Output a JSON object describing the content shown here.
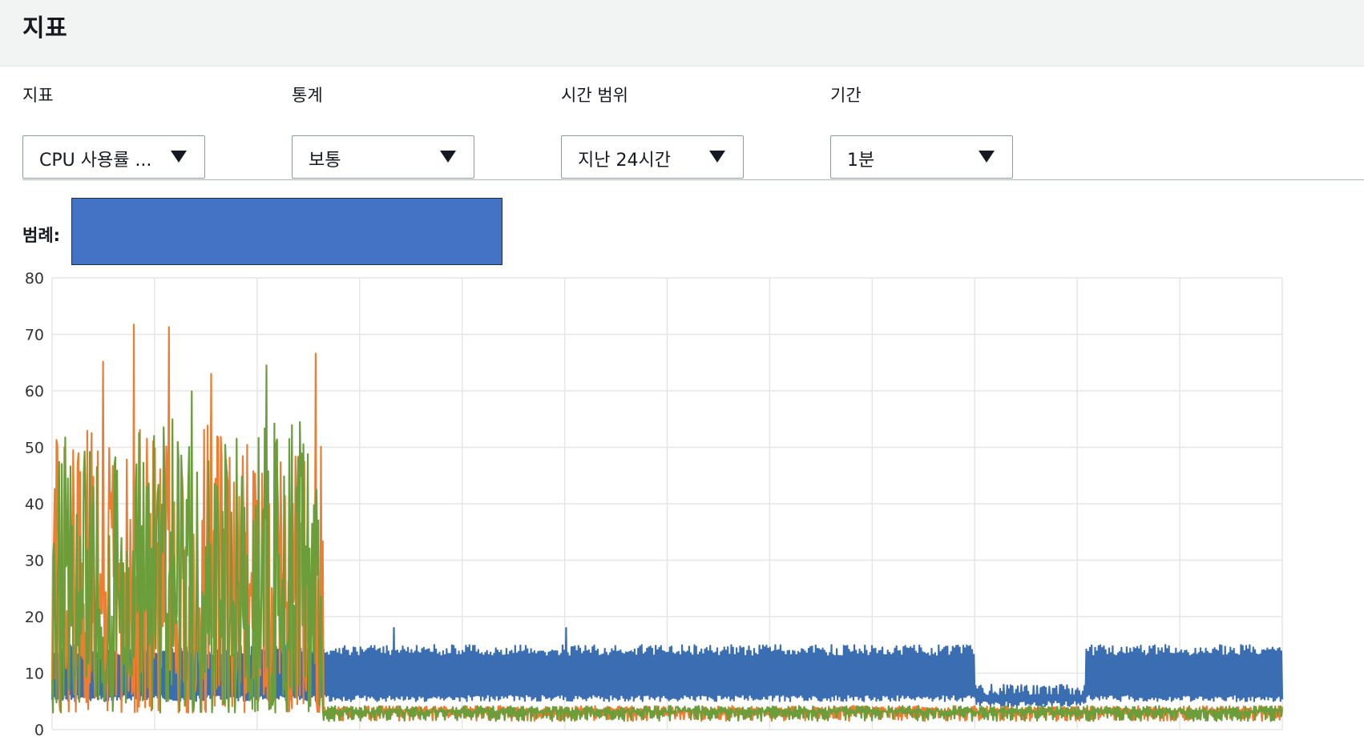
{
  "page": {
    "title": "지표"
  },
  "controls": {
    "metric": {
      "label": "지표",
      "value": "CPU 사용률 ..."
    },
    "statistic": {
      "label": "통계",
      "value": "보통"
    },
    "time_range": {
      "label": "시간 범위",
      "value": "지난 24시간"
    },
    "period": {
      "label": "기간",
      "value": "1분"
    }
  },
  "legend": {
    "label": "범례:"
  },
  "colors": {
    "blue": "#3a6db2",
    "orange": "#ed7d31",
    "green": "#6b9e3a",
    "grid": "#e6e6e6"
  },
  "chart_data": {
    "type": "line",
    "title": "",
    "xlabel": "",
    "ylabel": "",
    "ylim": [
      0,
      80
    ],
    "yticks": [
      0,
      10,
      20,
      30,
      40,
      50,
      60,
      70,
      80
    ],
    "x_grid_lines": 12,
    "grid": true,
    "x_domain": [
      0,
      1
    ],
    "series": [
      {
        "color": "blue",
        "profile": [
          {
            "from": 0.0,
            "to": 0.22,
            "low": 5,
            "high": 15,
            "peak": 23
          },
          {
            "from": 0.22,
            "to": 0.75,
            "low": 5,
            "high": 15,
            "peak": 18
          },
          {
            "from": 0.75,
            "to": 0.84,
            "low": 4,
            "high": 8,
            "peak": 12
          },
          {
            "from": 0.84,
            "to": 1.0,
            "low": 5,
            "high": 15,
            "peak": 23
          }
        ]
      },
      {
        "color": "orange",
        "profile": [
          {
            "from": 0.0,
            "to": 0.22,
            "low": 3,
            "high": 55,
            "peak": 73
          },
          {
            "from": 0.22,
            "to": 1.0,
            "low": 3,
            "high": 3.5,
            "peak": 4
          }
        ]
      },
      {
        "color": "green",
        "profile": [
          {
            "from": 0.0,
            "to": 0.22,
            "low": 3,
            "high": 55,
            "peak": 66
          },
          {
            "from": 0.22,
            "to": 1.0,
            "low": 3,
            "high": 3.5,
            "peak": 4
          }
        ]
      }
    ]
  }
}
